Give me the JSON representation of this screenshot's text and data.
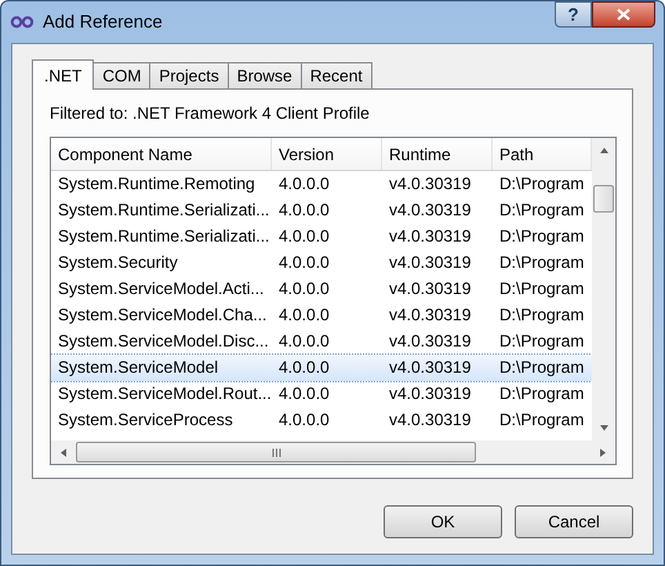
{
  "window": {
    "title": "Add Reference",
    "help": "?"
  },
  "tabs": [
    {
      "label": ".NET",
      "selected": true
    },
    {
      "label": "COM",
      "selected": false
    },
    {
      "label": "Projects",
      "selected": false
    },
    {
      "label": "Browse",
      "selected": false
    },
    {
      "label": "Recent",
      "selected": false
    }
  ],
  "filter_label": "Filtered to: .NET Framework 4 Client Profile",
  "table": {
    "columns": [
      "Component Name",
      "Version",
      "Runtime",
      "Path"
    ],
    "rows": [
      {
        "cells": [
          "System.Runtime.Remoting",
          "4.0.0.0",
          "v4.0.30319",
          "D:\\Program"
        ],
        "selected": false
      },
      {
        "cells": [
          "System.Runtime.Serializati...",
          "4.0.0.0",
          "v4.0.30319",
          "D:\\Program"
        ],
        "selected": false
      },
      {
        "cells": [
          "System.Runtime.Serializati...",
          "4.0.0.0",
          "v4.0.30319",
          "D:\\Program"
        ],
        "selected": false
      },
      {
        "cells": [
          "System.Security",
          "4.0.0.0",
          "v4.0.30319",
          "D:\\Program"
        ],
        "selected": false
      },
      {
        "cells": [
          "System.ServiceModel.Acti...",
          "4.0.0.0",
          "v4.0.30319",
          "D:\\Program"
        ],
        "selected": false
      },
      {
        "cells": [
          "System.ServiceModel.Cha...",
          "4.0.0.0",
          "v4.0.30319",
          "D:\\Program"
        ],
        "selected": false
      },
      {
        "cells": [
          "System.ServiceModel.Disc...",
          "4.0.0.0",
          "v4.0.30319",
          "D:\\Program"
        ],
        "selected": false
      },
      {
        "cells": [
          "System.ServiceModel",
          "4.0.0.0",
          "v4.0.30319",
          "D:\\Program"
        ],
        "selected": true
      },
      {
        "cells": [
          "System.ServiceModel.Rout...",
          "4.0.0.0",
          "v4.0.30319",
          "D:\\Program"
        ],
        "selected": false
      },
      {
        "cells": [
          "System.ServiceProcess",
          "4.0.0.0",
          "v4.0.30319",
          "D:\\Program"
        ],
        "selected": false
      }
    ]
  },
  "buttons": [
    "OK",
    "Cancel"
  ]
}
